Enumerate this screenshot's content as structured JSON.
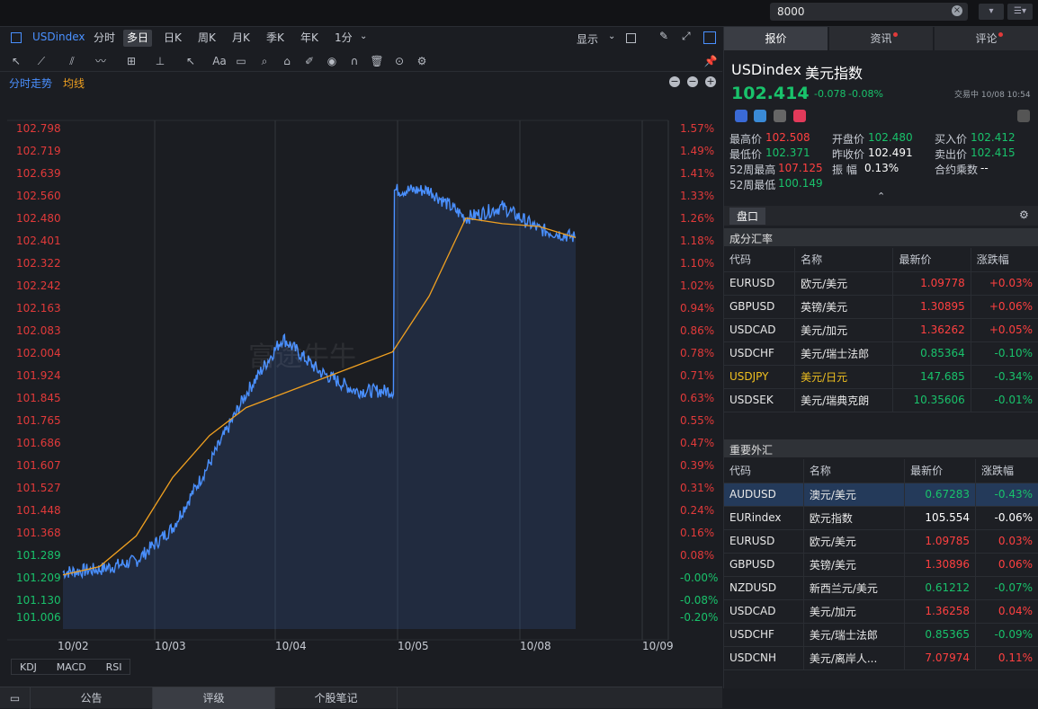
{
  "topbar": {
    "search_value": "8000",
    "clear_icon": "×"
  },
  "toolbar": {
    "symbol": "USDindex",
    "timeframes": [
      "分时",
      "多日",
      "日K",
      "周K",
      "月K",
      "季K",
      "年K",
      "1分"
    ],
    "active_tf": "多日",
    "display_label": "显示"
  },
  "legend": {
    "item1": "分时走势",
    "item2": "均线"
  },
  "yaxis": {
    "left": [
      "102.798",
      "102.719",
      "102.639",
      "102.560",
      "102.480",
      "102.401",
      "102.322",
      "102.242",
      "102.163",
      "102.083",
      "102.004",
      "101.924",
      "101.845",
      "101.765",
      "101.686",
      "101.607",
      "101.527",
      "101.448",
      "101.368",
      "101.289",
      "101.209",
      "101.130",
      "101.006"
    ],
    "right": [
      "1.57%",
      "1.49%",
      "1.41%",
      "1.33%",
      "1.26%",
      "1.18%",
      "1.10%",
      "1.02%",
      "0.94%",
      "0.86%",
      "0.78%",
      "0.71%",
      "0.63%",
      "0.55%",
      "0.47%",
      "0.39%",
      "0.31%",
      "0.24%",
      "0.16%",
      "0.08%",
      "-0.00%",
      "-0.08%",
      "-0.20%"
    ]
  },
  "xaxis": [
    "10/02",
    "10/03",
    "10/04",
    "10/05",
    "10/08",
    "10/09"
  ],
  "watermark": "富途牛牛",
  "indicators": [
    "KDJ",
    "MACD",
    "RSI"
  ],
  "bottom_tabs": [
    "公告",
    "评级",
    "个股笔记"
  ],
  "bottom_active": "评级",
  "right": {
    "tabs": [
      "报价",
      "资讯",
      "评论"
    ],
    "code": "USDindex",
    "name": "美元指数",
    "price": "102.414",
    "arrow": "↓",
    "change": "-0.078",
    "change_pct": "-0.08%",
    "trade_status": "交易中 10/08 10:54",
    "stats": {
      "high_label": "最高价",
      "high": "102.508",
      "open_label": "开盘价",
      "open": "102.480",
      "bid_label": "买入价",
      "bid": "102.412",
      "low_label": "最低价",
      "low": "102.371",
      "prev_label": "昨收价",
      "prev": "102.491",
      "ask_label": "卖出价",
      "ask": "102.415",
      "w52h_label": "52周最高",
      "w52h": "107.125",
      "amp_label": "振    幅",
      "amp": "0.13%",
      "mult_label": "合约乘数",
      "mult": "--",
      "w52l_label": "52周最低",
      "w52l": "100.149"
    },
    "pankou": "盘口",
    "sec1": {
      "title": "成分汇率",
      "headers": [
        "代码",
        "名称",
        "最新价",
        "涨跌幅"
      ],
      "rows": [
        {
          "code": "EURUSD",
          "name": "欧元/美元",
          "price": "1.09778",
          "chg": "+0.03%",
          "dir": "up"
        },
        {
          "code": "GBPUSD",
          "name": "英镑/美元",
          "price": "1.30895",
          "chg": "+0.06%",
          "dir": "up"
        },
        {
          "code": "USDCAD",
          "name": "美元/加元",
          "price": "1.36262",
          "chg": "+0.05%",
          "dir": "up"
        },
        {
          "code": "USDCHF",
          "name": "美元/瑞士法郎",
          "price": "0.85364",
          "chg": "-0.10%",
          "dir": "down"
        },
        {
          "code": "USDJPY",
          "name": "美元/日元",
          "price": "147.685",
          "chg": "-0.34%",
          "dir": "down",
          "hl": true
        },
        {
          "code": "USDSEK",
          "name": "美元/瑞典克朗",
          "price": "10.35606",
          "chg": "-0.01%",
          "dir": "down"
        }
      ]
    },
    "sec2": {
      "title": "重要外汇",
      "headers": [
        "代码",
        "名称",
        "最新价",
        "涨跌幅"
      ],
      "rows": [
        {
          "code": "AUDUSD",
          "name": "澳元/美元",
          "price": "0.67283",
          "chg": "-0.43%",
          "dir": "down",
          "sel": true
        },
        {
          "code": "EURindex",
          "name": "欧元指数",
          "price": "105.554",
          "chg": "-0.06%",
          "dir": "neutral"
        },
        {
          "code": "EURUSD",
          "name": "欧元/美元",
          "price": "1.09785",
          "chg": "0.03%",
          "dir": "up"
        },
        {
          "code": "GBPUSD",
          "name": "英镑/美元",
          "price": "1.30896",
          "chg": "0.06%",
          "dir": "up"
        },
        {
          "code": "NZDUSD",
          "name": "新西兰元/美元",
          "price": "0.61212",
          "chg": "-0.07%",
          "dir": "down"
        },
        {
          "code": "USDCAD",
          "name": "美元/加元",
          "price": "1.36258",
          "chg": "0.04%",
          "dir": "up"
        },
        {
          "code": "USDCHF",
          "name": "美元/瑞士法郎",
          "price": "0.85365",
          "chg": "-0.09%",
          "dir": "down"
        },
        {
          "code": "USDCNH",
          "name": "美元/离岸人...",
          "price": "7.07974",
          "chg": "0.11%",
          "dir": "up"
        }
      ]
    }
  },
  "colors": {
    "up": "#ff4040",
    "down": "#19c26b",
    "line": "#4a90ff",
    "avg": "#f0a020"
  },
  "chart_data": {
    "type": "line",
    "x": [
      "10/02",
      "10/03",
      "10/04",
      "10/05",
      "10/08"
    ],
    "series": [
      {
        "values": [
          101.21,
          101.22,
          101.25,
          101.37,
          101.6,
          101.85,
          102.05,
          101.93,
          101.86,
          101.86,
          102.58,
          102.48,
          102.52,
          102.44,
          102.41
        ]
      },
      {
        "values": [
          101.2,
          101.23,
          101.34,
          101.55,
          101.7,
          101.8,
          101.85,
          101.9,
          101.95,
          102.0,
          102.2,
          102.48,
          102.46,
          102.45,
          102.41
        ]
      }
    ],
    "ylim": [
      101.006,
      102.798
    ]
  }
}
